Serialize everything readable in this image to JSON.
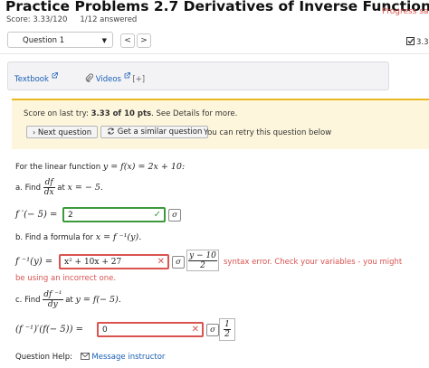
{
  "header": {
    "title": "Practice Problems 2.7 Derivatives of Inverse Functions",
    "progress": "Progress save",
    "score": "Score: 3.33/120",
    "answered": "1/12 answered"
  },
  "question_nav": {
    "selected": "Question 1",
    "prev": "<",
    "next": ">",
    "right_score": "3.33"
  },
  "resources": {
    "textbook": "Textbook",
    "videos": "Videos",
    "expand": "[+]"
  },
  "notice": {
    "score_prefix": "Score on last try: ",
    "score_value": "3.33 of 10 pts",
    "score_suffix": ". See Details for more.",
    "next_question": "Next question",
    "similar_question": "Get a similar question",
    "retry_text": "You can retry this question below"
  },
  "problem": {
    "intro_text": "For the linear function",
    "intro_math": "y = f(x) = 2x + 10:",
    "part_a_label": "a. Find",
    "part_a_num": "df",
    "part_a_den": "dx",
    "part_a_at": "at",
    "part_a_cond": "x = − 5.",
    "part_a_lhs": "f ′(− 5) =",
    "part_a_answer": "2",
    "part_b_label": "b. Find a formula for",
    "part_b_math": "x = f ⁻¹(y).",
    "part_b_lhs": "f ⁻¹(y) =",
    "part_b_answer": "x² + 10x + 27",
    "part_b_preview_num": "y − 10",
    "part_b_preview_den": "2",
    "part_b_error_1": "syntax error. Check your variables - you might",
    "part_b_error_2": "be using an incorrect one.",
    "part_c_label": "c. Find",
    "part_c_num": "df ⁻¹",
    "part_c_den": "dy",
    "part_c_at": "at",
    "part_c_cond": "y = f(− 5).",
    "part_c_lhs": "(f ⁻¹)′(f(− 5)) =",
    "part_c_answer": "0",
    "part_c_preview_num": "1",
    "part_c_preview_den": "2"
  },
  "footer": {
    "help_label": "Question Help:",
    "message": "Message instructor"
  }
}
